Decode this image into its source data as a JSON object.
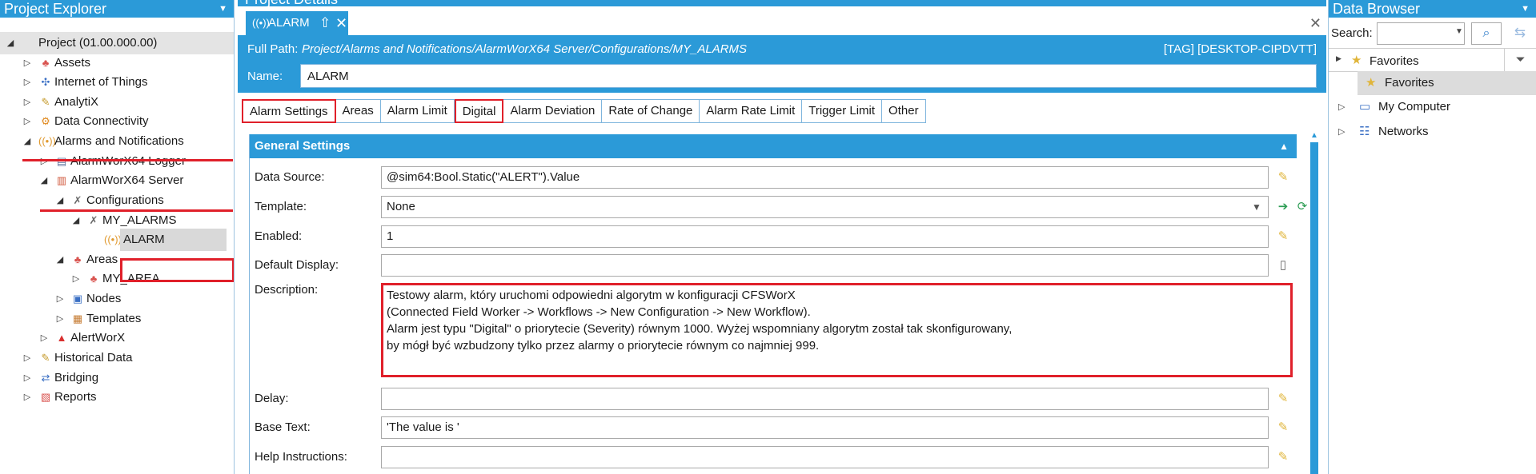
{
  "left_panel": {
    "title": "Project Explorer",
    "tree": [
      {
        "label": "Project (01.00.000.00)",
        "icon": "none",
        "level": 0,
        "arrow": "expanded"
      },
      {
        "label": "Assets",
        "icon": "assets-icon",
        "level": 1,
        "arrow": "collapsed"
      },
      {
        "label": "Internet of Things",
        "icon": "iot-icon",
        "level": 1,
        "arrow": "collapsed"
      },
      {
        "label": "AnalytiX",
        "icon": "analytix-icon",
        "level": 1,
        "arrow": "collapsed"
      },
      {
        "label": "Data Connectivity",
        "icon": "data-connectivity-icon",
        "level": 1,
        "arrow": "collapsed"
      },
      {
        "label": "Alarms and Notifications",
        "icon": "alarms-icon",
        "level": 1,
        "arrow": "expanded"
      },
      {
        "label": "AlarmWorX64 Logger",
        "icon": "logger-icon",
        "level": 2,
        "arrow": "collapsed"
      },
      {
        "label": "AlarmWorX64 Server",
        "icon": "server-icon",
        "level": 2,
        "arrow": "expanded"
      },
      {
        "label": "Configurations",
        "icon": "configurations-icon",
        "level": 3,
        "arrow": "expanded"
      },
      {
        "label": "MY_ALARMS",
        "icon": "tools-icon",
        "level": 4,
        "arrow": "expanded"
      },
      {
        "label": "ALARM",
        "icon": "alarm-icon",
        "level": 5,
        "arrow": "none"
      },
      {
        "label": "Areas",
        "icon": "areas-icon",
        "level": 3,
        "arrow": "expanded"
      },
      {
        "label": "MY_AREA",
        "icon": "area-icon",
        "level": 4,
        "arrow": "collapsed"
      },
      {
        "label": "Nodes",
        "icon": "nodes-icon",
        "level": 3,
        "arrow": "collapsed"
      },
      {
        "label": "Templates",
        "icon": "templates-icon",
        "level": 3,
        "arrow": "collapsed"
      },
      {
        "label": "AlertWorX",
        "icon": "warning-icon",
        "level": 2,
        "arrow": "collapsed"
      },
      {
        "label": "Historical Data",
        "icon": "historical-icon",
        "level": 1,
        "arrow": "collapsed"
      },
      {
        "label": "Bridging",
        "icon": "bridging-icon",
        "level": 1,
        "arrow": "collapsed"
      },
      {
        "label": "Reports",
        "icon": "reports-icon",
        "level": 1,
        "arrow": "collapsed"
      }
    ]
  },
  "center_panel": {
    "title": "Project Details",
    "document_tab": {
      "label": "ALARM"
    },
    "full_path_label": "Full Path:",
    "full_path_value": "Project/Alarms and Notifications/AlarmWorX64 Server/Configurations/MY_ALARMS",
    "tag_value": "[TAG] [DESKTOP-CIPDVTT]",
    "name_label": "Name:",
    "name_value": "ALARM",
    "tabs": [
      "Alarm Settings",
      "Areas",
      "Alarm Limit",
      "Digital",
      "Alarm Deviation",
      "Rate of Change",
      "Alarm Rate Limit",
      "Trigger Limit",
      "Other"
    ],
    "section_title": "General Settings",
    "fields": {
      "data_source_label": "Data Source:",
      "data_source_value": "@sim64:Bool.Static(\"ALERT\").Value",
      "template_label": "Template:",
      "template_value": "None",
      "enabled_label": "Enabled:",
      "enabled_value": "1",
      "default_display_label": "Default Display:",
      "default_display_value": "",
      "description_label": "Description:",
      "description_lines": [
        "Testowy alarm, który uruchomi odpowiedni algorytm w konfiguracji CFSWorX",
        "(Connected Field Worker -> Workflows -> New Configuration -> New Workflow).",
        "Alarm jest typu \"Digital\" o priorytecie (Severity) równym 1000. Wyżej wspomniany algorytm został tak skonfigurowany,",
        "by mógł być wzbudzony tylko przez alarmy o priorytecie równym co najmniej 999."
      ],
      "delay_label": "Delay:",
      "delay_value": "",
      "base_text_label": "Base Text:",
      "base_text_value": "'The value is '",
      "help_instructions_label": "Help Instructions:",
      "help_instructions_value": ""
    }
  },
  "right_panel": {
    "title": "Data Browser",
    "search_label": "Search:",
    "search_value": "",
    "favorites_header": "Favorites",
    "tree": [
      {
        "label": "Favorites",
        "icon": "star-icon",
        "arrow": "none",
        "selected": true
      },
      {
        "label": "My Computer",
        "icon": "computer-icon",
        "arrow": "collapsed",
        "selected": false
      },
      {
        "label": "Networks",
        "icon": "network-icon",
        "arrow": "collapsed",
        "selected": false
      }
    ]
  },
  "colors": {
    "accent": "#2b9ad8",
    "highlight_red": "#e0202a",
    "selected_gray": "#d9d9d9"
  }
}
